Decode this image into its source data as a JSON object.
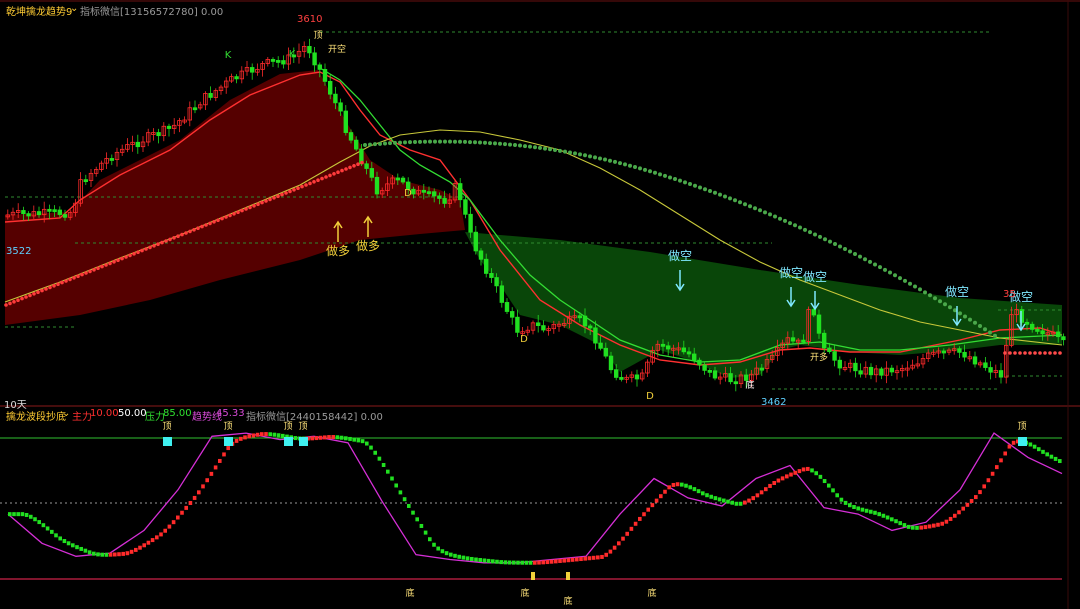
{
  "top_panel": {
    "indicator_name": "乾坤擒龙趋势9",
    "caption": "指标微信[13156572780] 0.00",
    "price_high": "3610",
    "price_low": "3462",
    "price_left": "3522",
    "period_label": "10天",
    "labels": {
      "do_long": "做多",
      "do_short": "做空",
      "open_short": "开空",
      "open_long": "开多",
      "top": "顶",
      "bottom": "底",
      "k": "K",
      "d": "D",
      "partial_right": "35"
    }
  },
  "bottom_panel": {
    "indicator_name": "擒龙波段抄底",
    "line1_label": "主力",
    "line1_value": "10.00",
    "mid_value": "50.00",
    "line2_label": "压力",
    "line2_value": "85.00",
    "line3_label": "趋势线",
    "line3_value": "45.33",
    "caption": "指标微信[2440158442] 0.00",
    "labels": {
      "top": "顶",
      "bottom": "底"
    }
  },
  "colors": {
    "up": "#ff2b2b",
    "down": "#21e021",
    "fill_red": "#5a0000",
    "fill_green": "#0a4a0a",
    "cyan": "#3ff0f0",
    "yellow": "#f2cf3a",
    "magenta": "#d52fd6"
  },
  "chart_data": [
    {
      "type": "candlestick",
      "yticks": [
        "3610",
        "3522",
        "3462"
      ],
      "annotations": [
        "做多",
        "做多",
        "做空",
        "做空",
        "做空",
        "做空",
        "做空",
        "开空",
        "开多",
        "顶",
        "底",
        "K",
        "D",
        "D",
        "D"
      ],
      "close_trend": [
        3522,
        3530,
        3545,
        3565,
        3585,
        3598,
        3610,
        3590,
        3560,
        3545,
        3540,
        3548,
        3530,
        3505,
        3488,
        3478,
        3470,
        3468,
        3462,
        3470,
        3475,
        3480,
        3478,
        3482,
        3476,
        3470,
        3485,
        3475
      ]
    },
    {
      "type": "line",
      "series": [
        {
          "name": "趋势线",
          "values": [
            40,
            22,
            14,
            16,
            30,
            55,
            88,
            90,
            86,
            88,
            84,
            48,
            15,
            12,
            10,
            10,
            12,
            14,
            40,
            62,
            50,
            45,
            62,
            70,
            44,
            40,
            30,
            35,
            55,
            90,
            75,
            65
          ]
        }
      ],
      "levels": {
        "主力": 10,
        "mid": 50,
        "压力": 85
      },
      "annotations": [
        "顶",
        "顶",
        "顶",
        "顶",
        "顶",
        "底",
        "底",
        "底",
        "底",
        "底"
      ]
    }
  ]
}
